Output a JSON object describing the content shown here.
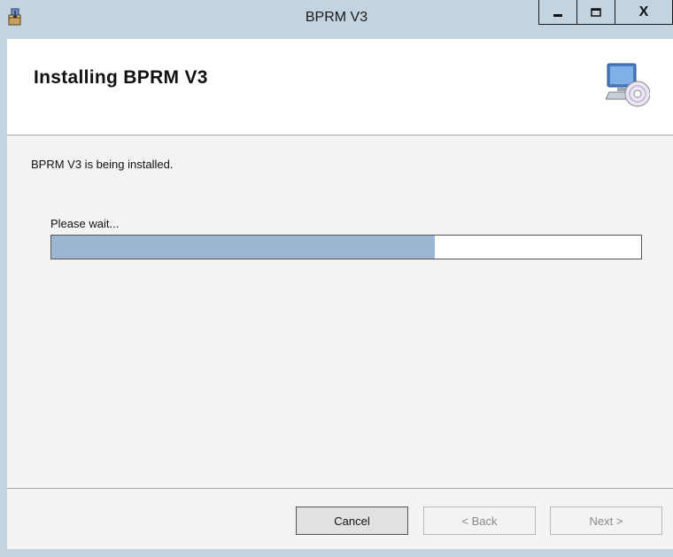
{
  "window": {
    "title": "BPRM V3",
    "app_icon": "installer-package-icon",
    "caption_buttons": {
      "minimize_icon": "minimize-icon",
      "maximize_icon": "maximize-icon",
      "close_label": "X"
    }
  },
  "header": {
    "title": "Installing BPRM V3",
    "icon": "computer-cd-icon"
  },
  "content": {
    "status": "BPRM V3 is being installed.",
    "wait_label": "Please wait...",
    "progress_fraction": 0.65
  },
  "footer": {
    "cancel_label": "Cancel",
    "back_label": "< Back",
    "next_label": "Next >"
  },
  "colors": {
    "frame": "#c3d3e0",
    "panel": "#f5f2f4",
    "progress_fill": "#9bb5d2",
    "disabled_text": "#8a8a8a"
  }
}
